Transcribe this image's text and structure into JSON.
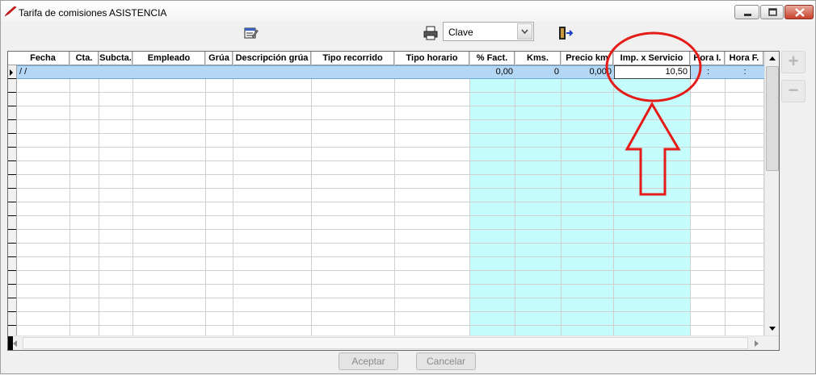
{
  "window": {
    "title": "Tarifa de comisiones ASISTENCIA"
  },
  "toolbar": {
    "edit_icon": "edit-icon",
    "print_icon": "printer-icon",
    "exit_icon": "exit-door-icon",
    "order_select": {
      "value": "Clave"
    }
  },
  "grid": {
    "columns": [
      {
        "key": "fecha",
        "label": "Fecha",
        "highlight": false
      },
      {
        "key": "cta",
        "label": "Cta.",
        "highlight": false
      },
      {
        "key": "subcta",
        "label": "Subcta.",
        "highlight": false
      },
      {
        "key": "empleado",
        "label": "Empleado",
        "highlight": false
      },
      {
        "key": "grua",
        "label": "Grúa",
        "highlight": false
      },
      {
        "key": "descripcion_grua",
        "label": "Descripción grúa",
        "highlight": false
      },
      {
        "key": "tipo_recorrido",
        "label": "Tipo recorrido",
        "highlight": false
      },
      {
        "key": "tipo_horario",
        "label": "Tipo horario",
        "highlight": false
      },
      {
        "key": "pct_fact",
        "label": "% Fact.",
        "highlight": true
      },
      {
        "key": "kms",
        "label": "Kms.",
        "highlight": true
      },
      {
        "key": "precio_km",
        "label": "Precio km",
        "highlight": true
      },
      {
        "key": "imp_servicio",
        "label": "Imp. x Servicio",
        "highlight": true
      },
      {
        "key": "hora_i",
        "label": "Hora I.",
        "highlight": false
      },
      {
        "key": "hora_f",
        "label": "Hora F.",
        "highlight": false
      }
    ],
    "rows": [
      {
        "fecha": "/  /",
        "cta": "",
        "subcta": "",
        "empleado": "",
        "grua": "",
        "descripcion_grua": "",
        "tipo_recorrido": "",
        "tipo_horario": "",
        "pct_fact": "0,00",
        "kms": "0",
        "precio_km": "0,000",
        "imp_servicio": "10,50",
        "hora_i": ":",
        "hora_f": ":"
      }
    ]
  },
  "side_buttons": {
    "add": "+",
    "remove": "−"
  },
  "footer": {
    "accept_label": "Aceptar",
    "cancel_label": "Cancelar"
  },
  "colors": {
    "highlight_column": "#c5fcfc",
    "selected_row": "#b4d7f5",
    "annotation": "#e41b17"
  }
}
